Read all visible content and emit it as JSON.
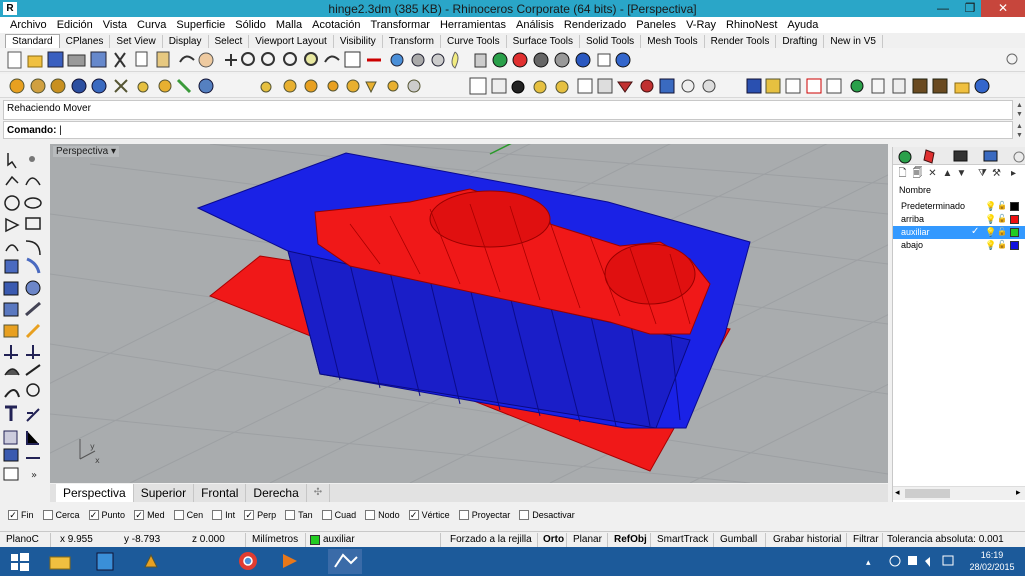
{
  "window": {
    "title": "hinge2.3dm (385 KB) - Rhinoceros Corporate (64 bits) - [Perspectiva]",
    "minimize": "—",
    "maximize": "❐",
    "close": "✕"
  },
  "menu": [
    "Archivo",
    "Edición",
    "Vista",
    "Curva",
    "Superficie",
    "Sólido",
    "Malla",
    "Acotación",
    "Transformar",
    "Herramientas",
    "Análisis",
    "Renderizado",
    "Paneles",
    "V-Ray",
    "RhinoNest",
    "Ayuda"
  ],
  "toolbar_tabs": [
    "Standard",
    "CPlanes",
    "Set View",
    "Display",
    "Select",
    "Viewport Layout",
    "Visibility",
    "Transform",
    "Curve Tools",
    "Surface Tools",
    "Solid Tools",
    "Mesh Tools",
    "Render Tools",
    "Drafting",
    "New in V5"
  ],
  "command": {
    "history": "Rehaciendo Mover",
    "prompt": "Comando:"
  },
  "viewport": {
    "label": "Perspectiva",
    "menu_arrow": "▾",
    "axis_x": "x",
    "axis_y": "y",
    "colors": {
      "background": "#a9acae",
      "blue_mesh": "#1a22e6",
      "red_mesh": "#f01818"
    }
  },
  "viewport_tabs": [
    "Perspectiva",
    "Superior",
    "Frontal",
    "Derecha"
  ],
  "viewport_tab_add": "✣",
  "layers_panel": {
    "column_header": "Nombre",
    "layers": [
      {
        "name": "Predeterminado",
        "color": "#000000",
        "selected": false
      },
      {
        "name": "arriba",
        "color": "#ee1111",
        "selected": false
      },
      {
        "name": "auxiliar",
        "color": "#22cc22",
        "selected": true
      },
      {
        "name": "abajo",
        "color": "#1111dd",
        "selected": false
      }
    ]
  },
  "osnaps": [
    {
      "label": "Fin",
      "checked": true
    },
    {
      "label": "Cerca",
      "checked": false
    },
    {
      "label": "Punto",
      "checked": true
    },
    {
      "label": "Med",
      "checked": true
    },
    {
      "label": "Cen",
      "checked": false
    },
    {
      "label": "Int",
      "checked": false
    },
    {
      "label": "Perp",
      "checked": true
    },
    {
      "label": "Tan",
      "checked": false
    },
    {
      "label": "Cuad",
      "checked": false
    },
    {
      "label": "Nodo",
      "checked": false
    },
    {
      "label": "Vértice",
      "checked": true
    },
    {
      "label": "Proyectar",
      "checked": false
    },
    {
      "label": "Desactivar",
      "checked": false
    }
  ],
  "status": {
    "cplane": "PlanoC",
    "x": "x 9.955",
    "y": "y -8.793",
    "z": "z 0.000",
    "units": "Milímetros",
    "layer": "auxiliar",
    "snap_grid": "Forzado a la rejilla",
    "ortho": "Orto",
    "planar": "Planar",
    "refobj": "RefObj",
    "smarttrack": "SmartTrack",
    "gumball": "Gumball",
    "history": "Grabar historial",
    "filter": "Filtrar",
    "tolerance": "Tolerancia absoluta: 0.001"
  },
  "taskbar": {
    "time": "16:19",
    "date": "28/02/2015"
  }
}
